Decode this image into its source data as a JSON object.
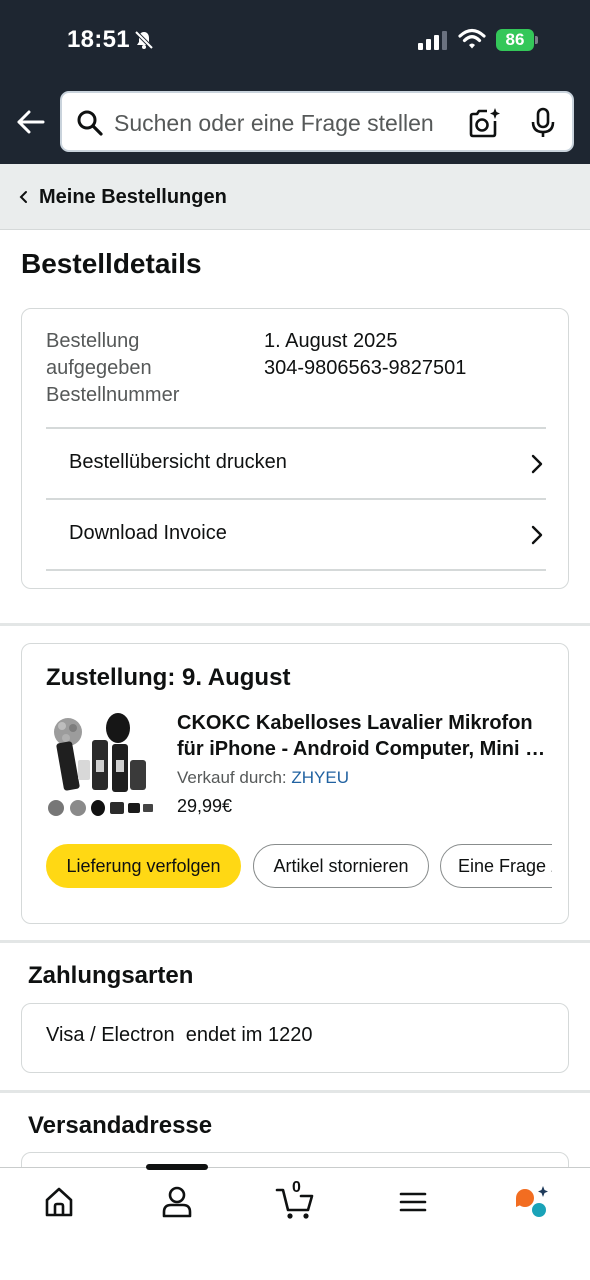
{
  "status_bar": {
    "time": "18:51",
    "battery": "86"
  },
  "search": {
    "placeholder": "Suchen oder eine Frage stellen"
  },
  "breadcrumb": {
    "label": "Meine Bestellungen"
  },
  "page_title": "Bestelldetails",
  "order": {
    "placed_label_line1": "Bestellung",
    "placed_label_line2": "aufgegeben",
    "placed_value": "1. August 2025",
    "number_label": "Bestellnummer",
    "number_value": "304-9806563-9827501",
    "links": [
      "Bestellübersicht drucken",
      "Download Invoice"
    ]
  },
  "shipment": {
    "delivery": "Zustellung: 9. August",
    "title_line1": "CKOKC Kabelloses Lavalier Mikrofon",
    "title_line2": "für iPhone - Android Computer, Mini Clip",
    "seller_label": "Verkauf durch:",
    "seller_name": "ZHYEU",
    "price": "29,99€",
    "buttons": [
      "Lieferung verfolgen",
      "Artikel stornieren",
      "Eine Frage zum Produkt stellen"
    ]
  },
  "payment": {
    "heading": "Zahlungsarten",
    "method": "Visa / Electron",
    "ending": "endet im 1220"
  },
  "shipping": {
    "heading": "Versandadresse"
  },
  "tabbar": {
    "cart_count": "0"
  },
  "colors": {
    "header_bg": "#1e2631",
    "accent_yellow": "#ffd814",
    "link_blue": "#2162a1",
    "battery_green": "#34c759"
  }
}
